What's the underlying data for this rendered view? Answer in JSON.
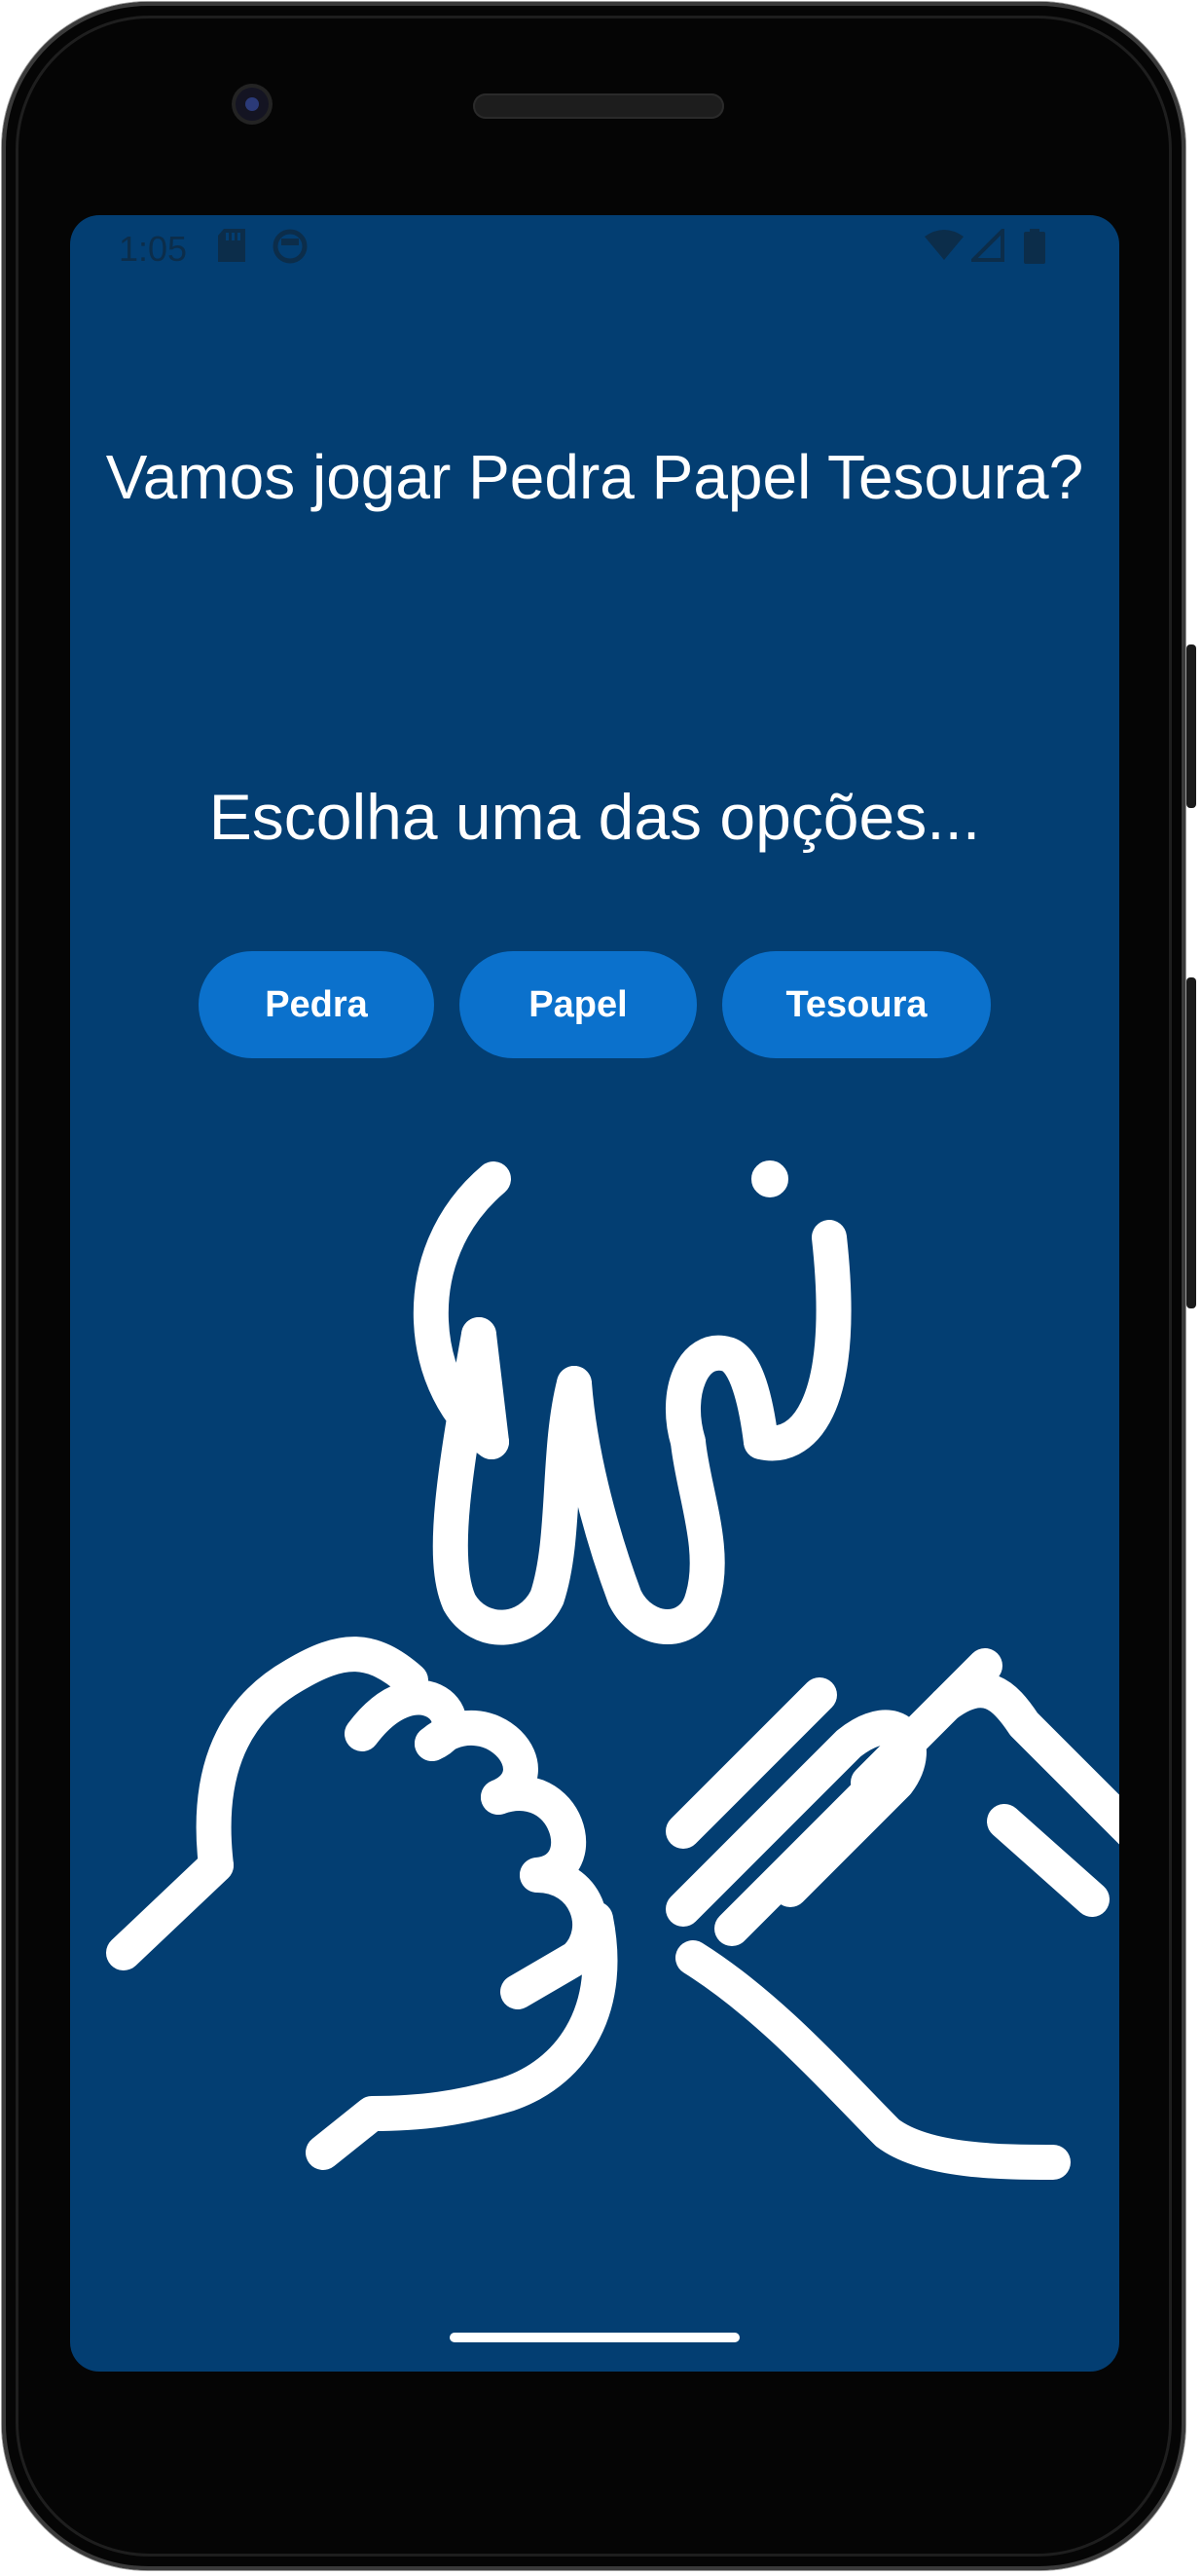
{
  "status_bar": {
    "time": "1:05",
    "left_icons": [
      "sd-card-icon",
      "circle-face-icon"
    ],
    "right_icons": [
      "wifi-icon",
      "signal-icon",
      "battery-icon"
    ]
  },
  "main": {
    "title": "Vamos jogar Pedra Papel Tesoura?",
    "subtitle": "Escolha uma das opções...",
    "options": [
      {
        "label": "Pedra"
      },
      {
        "label": "Papel"
      },
      {
        "label": "Tesoura"
      }
    ],
    "illustration": "rock-paper-scissors-hands-icon"
  },
  "colors": {
    "background": "#033e72",
    "button": "#0b71cc",
    "text": "#ffffff"
  }
}
